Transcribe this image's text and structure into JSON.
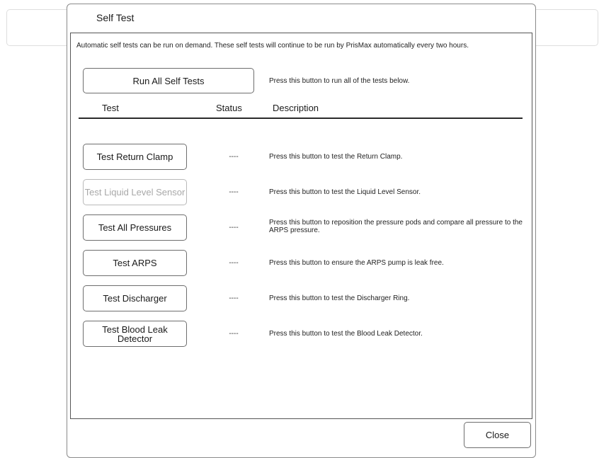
{
  "dialog": {
    "title": "Self Test",
    "intro": "Automatic self tests can be run on demand. These self tests will continue to be run by PrisMax automatically every two hours.",
    "run_all_label": "Run All Self Tests",
    "run_all_desc": "Press this button to run all of the tests below.",
    "columns": {
      "test": "Test",
      "status": "Status",
      "description": "Description"
    },
    "tests": [
      {
        "label": "Test Return Clamp",
        "status": "----",
        "description": "Press this button to test the Return Clamp.",
        "enabled": true
      },
      {
        "label": "Test Liquid Level Sensor",
        "status": "----",
        "description": "Press this button to test the Liquid Level Sensor.",
        "enabled": false
      },
      {
        "label": "Test All Pressures",
        "status": "----",
        "description": "Press this button to reposition the pressure pods and compare all pressure to the ARPS pressure.",
        "enabled": true
      },
      {
        "label": "Test ARPS",
        "status": "----",
        "description": "Press this button to ensure the ARPS pump is leak free.",
        "enabled": true
      },
      {
        "label": "Test Discharger",
        "status": "----",
        "description": "Press this button to test the Discharger Ring.",
        "enabled": true
      },
      {
        "label": "Test Blood Leak Detector",
        "status": "----",
        "description": "Press this button to test the Blood Leak Detector.",
        "enabled": true
      }
    ],
    "close_label": "Close"
  }
}
